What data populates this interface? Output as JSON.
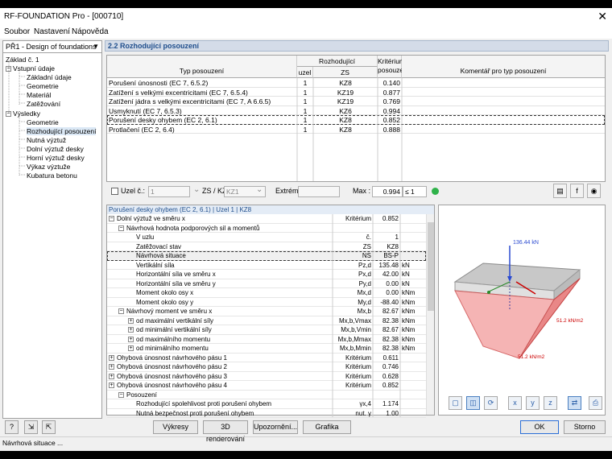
{
  "window": {
    "title": "RF-FOUNDATION Pro - [000710]",
    "close": "✕"
  },
  "menu": [
    "Soubor",
    "Nastavení",
    "Nápověda"
  ],
  "case_select": "PŘ1 - Design of foundations",
  "tree": {
    "root": "Základ č. 1",
    "input": "Vstupní údaje",
    "input_items": [
      "Základní údaje",
      "Geometrie",
      "Materiál",
      "Zatěžování"
    ],
    "results": "Výsledky",
    "result_items": [
      "Geometrie",
      "Rozhodující posouzení",
      "Nutná výztuž",
      "Dolní výztuž desky",
      "Horní výztuž desky",
      "Výkaz výztuže",
      "Kubatura betonu"
    ]
  },
  "section_title": "2.2 Rozhodující posouzení",
  "table1": {
    "headers": {
      "type": "Typ posouzení",
      "decisive": "Rozhodující",
      "node": "uzel",
      "zs": "ZS",
      "crit1": "Kritérium",
      "crit2": "posouzení",
      "comment": "Komentář pro typ posouzení"
    },
    "rows": [
      {
        "type": "Porušení únosnosti (EC 7, 6.5.2)",
        "node": "1",
        "zs": "KZ8",
        "crit": "0.140"
      },
      {
        "type": "Zatížení s velkými excentricitami (EC 7, 6.5.4)",
        "node": "1",
        "zs": "KZ19",
        "crit": "0.877"
      },
      {
        "type": "Zatížení jádra s velkými excentricitami (EC 7, A 6.6.5)",
        "node": "1",
        "zs": "KZ19",
        "crit": "0.769"
      },
      {
        "type": "Usmyknutí (EC 7, 6.5.3)",
        "node": "1",
        "zs": "KZ6",
        "crit": "0.994"
      },
      {
        "type": "Porušení desky ohybem (EC 2, 6.1)",
        "node": "1",
        "zs": "KZ8",
        "crit": "0.852"
      },
      {
        "type": "Protlačení (EC 2, 6.4)",
        "node": "1",
        "zs": "KZ8",
        "crit": "0.888"
      }
    ]
  },
  "filter": {
    "node_label": "Uzel č.:",
    "node_value": "1",
    "zs_label": "ZS / KZ:",
    "zs_value": "KZ1",
    "extrem_label": "Extrém:",
    "max_label": "Max :",
    "max_value": "0.994",
    "le": "≤ 1"
  },
  "detail": {
    "header": "Porušení desky ohybem (EC 2, 6.1) | Uzel 1 | KZ8",
    "rows": [
      {
        "label": "Dolní výztuž ve směru x",
        "sym": "Kritérium",
        "val": "0.852",
        "unit": "",
        "lvl": 0,
        "box": "−"
      },
      {
        "label": "Návrhová hodnota podporových sil a momentů",
        "sym": "",
        "val": "",
        "unit": "",
        "lvl": 1,
        "box": "−"
      },
      {
        "label": "V uzlu",
        "sym": "č.",
        "val": "1",
        "unit": "",
        "lvl": 2,
        "box": ""
      },
      {
        "label": "Zatěžovací stav",
        "sym": "ZS",
        "val": "KZ8",
        "unit": "",
        "lvl": 2,
        "box": ""
      },
      {
        "label": "Návrhová situace",
        "sym": "NS",
        "val": "BS-P",
        "unit": "",
        "lvl": 2,
        "box": "",
        "hl": true
      },
      {
        "label": "Vertikální síla",
        "sym": "Pz,d",
        "val": "135.48",
        "unit": "kN",
        "lvl": 2,
        "box": ""
      },
      {
        "label": "Horizontální síla ve směru x",
        "sym": "Px,d",
        "val": "42.00",
        "unit": "kN",
        "lvl": 2,
        "box": ""
      },
      {
        "label": "Horizontální síla ve směru y",
        "sym": "Py,d",
        "val": "0.00",
        "unit": "kN",
        "lvl": 2,
        "box": ""
      },
      {
        "label": "Moment okolo osy x",
        "sym": "Mx,d",
        "val": "0.00",
        "unit": "kNm",
        "lvl": 2,
        "box": ""
      },
      {
        "label": "Moment okolo osy y",
        "sym": "My,d",
        "val": "-88.40",
        "unit": "kNm",
        "lvl": 2,
        "box": ""
      },
      {
        "label": "Návrhový moment ve směru x",
        "sym": "Mx,b",
        "val": "82.67",
        "unit": "kNm",
        "lvl": 1,
        "box": "−"
      },
      {
        "label": "od maximální vertikální síly",
        "sym": "Mx,b,Vmax",
        "val": "82.38",
        "unit": "kNm",
        "lvl": 2,
        "box": "+"
      },
      {
        "label": "od minimální vertikální síly",
        "sym": "Mx,b,Vmin",
        "val": "82.67",
        "unit": "kNm",
        "lvl": 2,
        "box": "+"
      },
      {
        "label": "od maximálního momentu",
        "sym": "Mx,b,Mmax",
        "val": "82.38",
        "unit": "kNm",
        "lvl": 2,
        "box": "+"
      },
      {
        "label": "od minimálního momentu",
        "sym": "Mx,b,Mmin",
        "val": "82.38",
        "unit": "kNm",
        "lvl": 2,
        "box": "+"
      },
      {
        "label": "Ohybová únosnost návrhového pásu 1",
        "sym": "Kritérium",
        "val": "0.611",
        "unit": "",
        "lvl": 0,
        "box": "+"
      },
      {
        "label": "Ohybová únosnost návrhového pásu 2",
        "sym": "Kritérium",
        "val": "0.746",
        "unit": "",
        "lvl": 0,
        "box": "+"
      },
      {
        "label": "Ohybová únosnost návrhového pásu 3",
        "sym": "Kritérium",
        "val": "0.628",
        "unit": "",
        "lvl": 0,
        "box": "+"
      },
      {
        "label": "Ohybová únosnost návrhového pásu 4",
        "sym": "Kritérium",
        "val": "0.852",
        "unit": "",
        "lvl": 0,
        "box": "+"
      },
      {
        "label": "Posouzení",
        "sym": "",
        "val": "",
        "unit": "",
        "lvl": 1,
        "box": "−"
      },
      {
        "label": "Rozhodující spolehlivost proti porušení ohybem",
        "sym": "γx,4",
        "val": "1.174",
        "unit": "",
        "lvl": 2,
        "box": ""
      },
      {
        "label": "Nutná bezpečnost proti porušení ohybem",
        "sym": "nut. γ",
        "val": "1.00",
        "unit": "",
        "lvl": 2,
        "box": ""
      }
    ]
  },
  "graphic": {
    "label_top": "136.44 kN",
    "label_right": "51.2 kN/m2",
    "label_bottom": "51.2 kN/m2"
  },
  "buttons": {
    "vykresy": "Výkresy",
    "render": "3D renderování",
    "upozorneni": "Upozornění...",
    "grafika": "Grafika",
    "ok": "OK",
    "storno": "Storno"
  },
  "status": "Návrhová situace ..."
}
